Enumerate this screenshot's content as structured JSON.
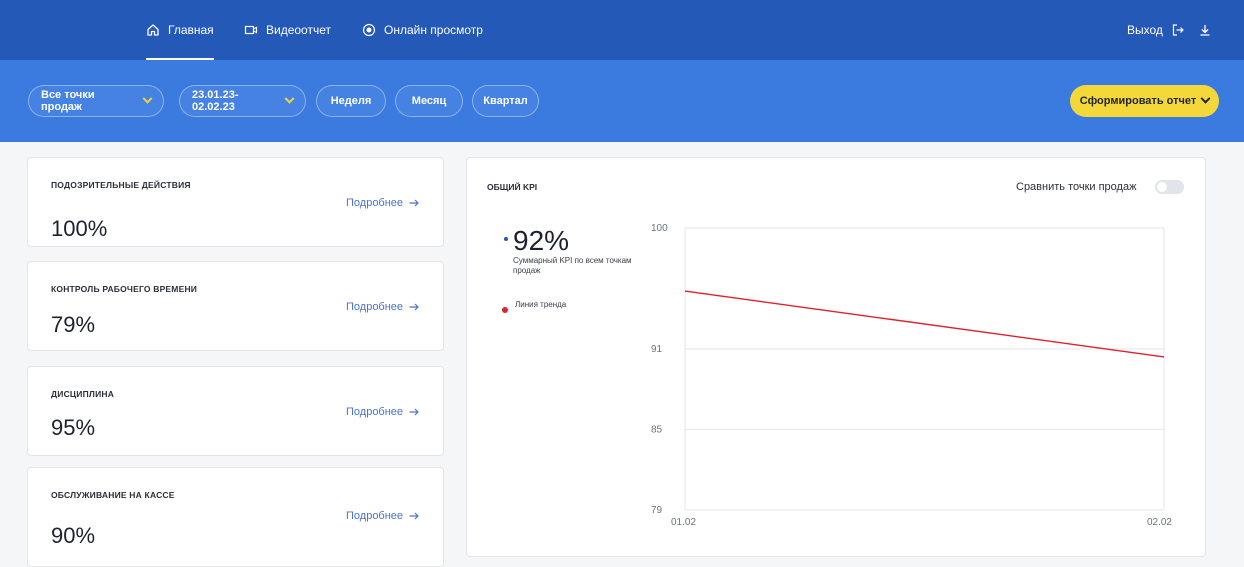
{
  "colors": {
    "nav": "#2459b8",
    "filter_bar": "#3b7be0",
    "accent": "#f4d83a",
    "trend_line": "#e0202c",
    "link": "#4a73d4"
  },
  "nav": {
    "items": [
      {
        "label": "Главная",
        "icon": "home-icon",
        "active": true
      },
      {
        "label": "Видеоотчет",
        "icon": "video-camera-icon",
        "active": false
      },
      {
        "label": "Онлайн просмотр",
        "icon": "live-dot-icon",
        "active": false
      }
    ],
    "logout_label": "Выход",
    "logout_icon": "logout-icon",
    "download_icon": "download-icon"
  },
  "filters": {
    "points": "Все точки продаж",
    "date_range": "23.01.23-02.02.23",
    "periods": [
      "Неделя",
      "Месяц",
      "Квартал"
    ],
    "report_button": "Сформировать отчет"
  },
  "cards": [
    {
      "title": "ПОДОЗРИТЕЛЬНЫЕ ДЕЙСТВИЯ",
      "value": "100%",
      "link": "Подробнее"
    },
    {
      "title": "КОНТРОЛЬ РАБОЧЕГО ВРЕМЕНИ",
      "value": "79%",
      "link": "Подробнее"
    },
    {
      "title": "ДИСЦИПЛИНА",
      "value": "95%",
      "link": "Подробнее"
    },
    {
      "title": "ОБСЛУЖИВАНИЕ НА КАССЕ",
      "value": "90%",
      "link": "Подробнее"
    }
  ],
  "kpi_panel": {
    "title": "ОБЩИЙ KPI",
    "compare_label": "Сравнить точки продаж",
    "compare_enabled": false,
    "total_value": "92%",
    "total_caption": "Суммарный KPI по всем точкам продаж",
    "trend_label": "Линия тренда"
  },
  "chart_data": {
    "type": "line",
    "x": [
      "01.02",
      "02.02"
    ],
    "series": [
      {
        "name": "Линия тренда",
        "values": [
          95.3,
          90.4
        ]
      }
    ],
    "yticks": [
      79,
      85,
      91,
      100
    ],
    "ylim": [
      79,
      100
    ],
    "grid": true,
    "legend": "left"
  }
}
